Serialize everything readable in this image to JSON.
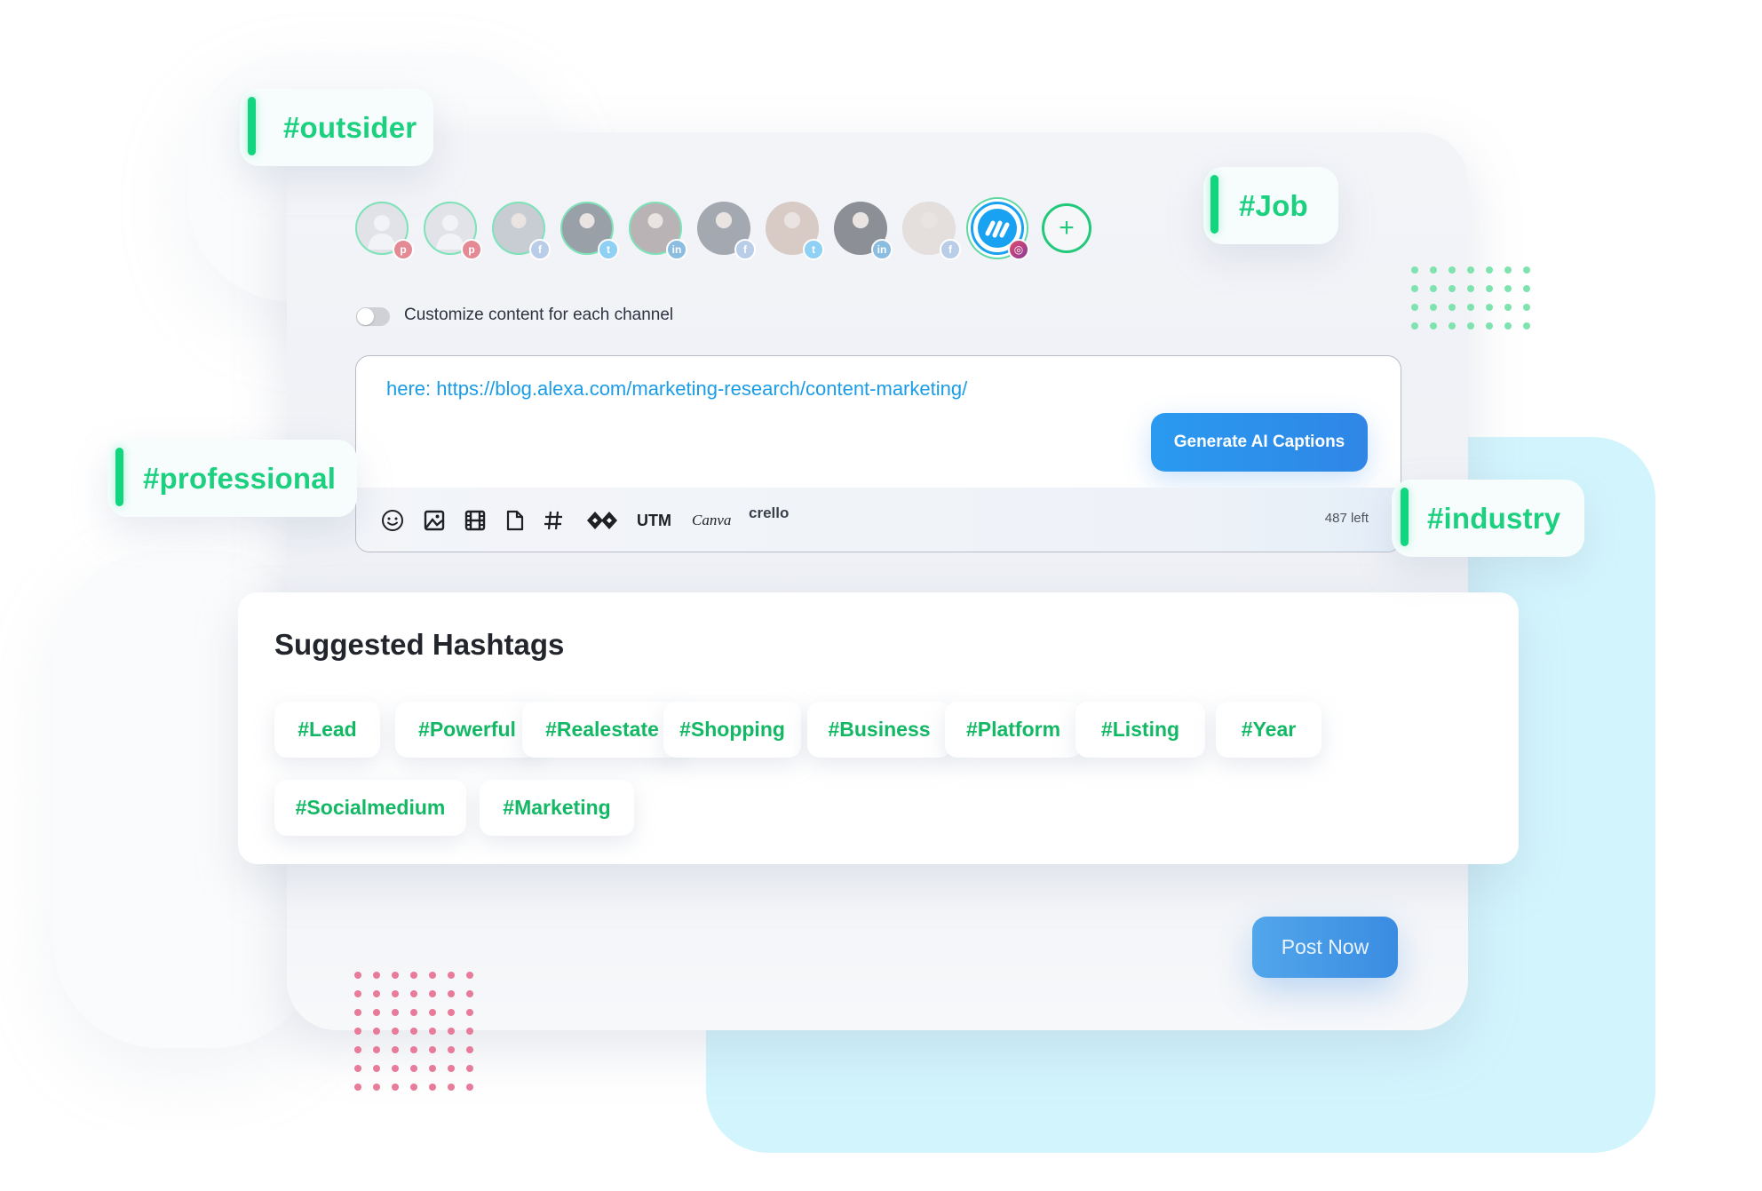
{
  "floating_tags": [
    {
      "text": "#outsider"
    },
    {
      "text": "#Job"
    },
    {
      "text": "#professional"
    },
    {
      "text": "#industry"
    }
  ],
  "channels": {
    "avatars": [
      {
        "kind": "placeholder",
        "network": "pinterest",
        "network_glyph": "p"
      },
      {
        "kind": "placeholder",
        "network": "pinterest",
        "network_glyph": "p"
      },
      {
        "kind": "photo",
        "network": "facebook",
        "network_glyph": "f"
      },
      {
        "kind": "photo",
        "network": "twitter",
        "network_glyph": "t"
      },
      {
        "kind": "photo",
        "network": "linkedin",
        "network_glyph": "in"
      },
      {
        "kind": "photo",
        "network": "facebook",
        "network_glyph": "f"
      },
      {
        "kind": "photo",
        "network": "twitter",
        "network_glyph": "t"
      },
      {
        "kind": "photo",
        "network": "linkedin",
        "network_glyph": "in"
      },
      {
        "kind": "photo",
        "network": "facebook",
        "network_glyph": "f"
      },
      {
        "kind": "brand",
        "network": "instagram",
        "network_glyph": "◎",
        "selected": true
      }
    ],
    "add_label": "+"
  },
  "customize": {
    "label": "Customize content for each channel",
    "enabled": false
  },
  "editor": {
    "text": "here: https://blog.alexa.com/marketing-research/content-marketing/",
    "generate_label": "Generate AI Captions",
    "toolbar": {
      "emoji_icon": "emoji-icon",
      "image_icon": "image-icon",
      "video_icon": "film-icon",
      "document_icon": "document-icon",
      "hashtag_icon": "hashtag-icon",
      "link_icon": "link-shortener-icon",
      "utm_label": "UTM",
      "canva_label": "Canva",
      "crello_label": "crello"
    },
    "chars_left": "487 left"
  },
  "suggested_hashtags": {
    "title": "Suggested Hashtags",
    "tags": [
      "#Lead",
      "#Powerful",
      "#Realestate",
      "#Shopping",
      "#Business",
      "#Platform",
      "#Listing",
      "#Year",
      "#Socialmedium",
      "#Marketing"
    ]
  },
  "post_now_label": "Post Now",
  "colors": {
    "accent_green": "#12d67f",
    "hashtag_green": "#13b865",
    "primary_blue": "#2f8fea",
    "link_blue": "#1a9ce6",
    "cyan_backdrop": "#d2f5fd",
    "dot_pink": "#e87a9a",
    "dot_green": "#7fe3b0"
  }
}
